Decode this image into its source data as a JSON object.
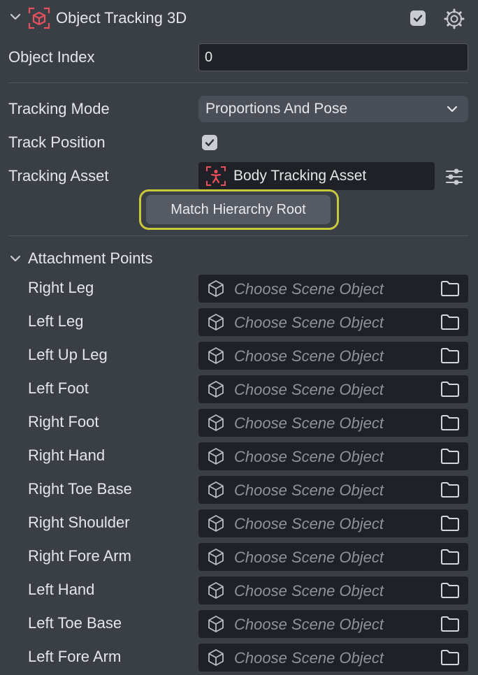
{
  "header": {
    "title": "Object Tracking 3D",
    "enabled": true
  },
  "object_index": {
    "label": "Object Index",
    "value": "0"
  },
  "tracking_mode": {
    "label": "Tracking Mode",
    "value": "Proportions And Pose"
  },
  "track_position": {
    "label": "Track Position",
    "checked": true
  },
  "tracking_asset": {
    "label": "Tracking Asset",
    "value": "Body Tracking Asset"
  },
  "match_button": {
    "label": "Match Hierarchy Root"
  },
  "attachment_points": {
    "label": "Attachment Points",
    "placeholder": "Choose Scene Object",
    "items": [
      {
        "label": "Right Leg"
      },
      {
        "label": "Left Leg"
      },
      {
        "label": "Left Up Leg"
      },
      {
        "label": "Left Foot"
      },
      {
        "label": "Right Foot"
      },
      {
        "label": "Right Hand"
      },
      {
        "label": "Right Toe Base"
      },
      {
        "label": "Right Shoulder"
      },
      {
        "label": "Right Fore Arm"
      },
      {
        "label": "Left Hand"
      },
      {
        "label": "Left Toe Base"
      },
      {
        "label": "Left Fore Arm"
      }
    ]
  },
  "colors": {
    "background": "#3a3e45",
    "field": "#1f2126",
    "dropdown": "#4a4e56",
    "button_outline": "#c8c83a",
    "asset_icon": "#e8505b"
  }
}
